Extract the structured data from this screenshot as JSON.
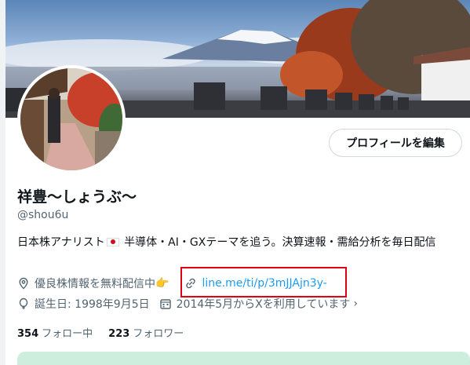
{
  "profile": {
    "edit_button_label": "プロフィールを編集",
    "display_name": "祥豊〜しょうぶ〜",
    "handle": "@shou6u",
    "bio_part1": "日本株アナリスト",
    "bio_part2": " 半導体・AI・GXテーマを追う。決算速報・需給分析を毎日配信"
  },
  "meta": {
    "location": "優良株情報を無料配信中",
    "location_emoji": "👉",
    "link": "line.me/ti/p/3mJJAjn3y-",
    "birthday": "誕生日: 1998年9月5日",
    "joined": "2014年5月からXを利用しています"
  },
  "stats": {
    "following_count": "354",
    "following_label": "フォロー中",
    "followers_count": "223",
    "followers_label": "フォロワー"
  },
  "colors": {
    "link": "#1d9bf0",
    "secondary_text": "#536471",
    "highlight": "#e0000f",
    "card": "#cdeedd"
  }
}
